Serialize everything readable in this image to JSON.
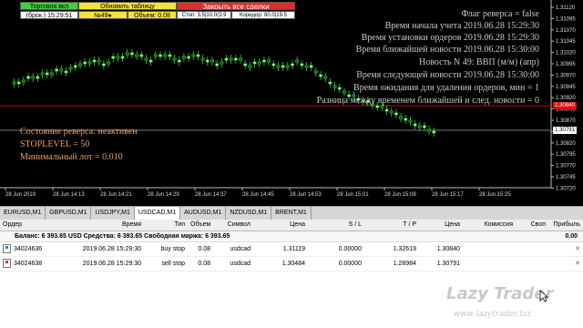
{
  "panel": {
    "row1": [
      "Торговля вкл",
      "Обновить таблицу",
      "Закрыть все сделки"
    ],
    "row2": [
      "(брок.) 15:29:51",
      "№49●",
      "Объем: 0.08",
      "Стоп: 3.5|10.0(3.9",
      "Коридор: 80.0|19.5"
    ],
    "colors": {
      "green": "#3dd23d",
      "yellow": "#f2e23a",
      "red": "#e12c2c",
      "white": "#ffffff"
    }
  },
  "info_lines": [
    "Флаг реверса = false",
    "Время начала учета 2019.06.28 15:29:30",
    "Время установки ордеров 2019.06.28 15:29:30",
    "Время ближайшей новости 2019.06.28 15:30:00",
    "Новость N 49: ВВП (м/м)  (апр)",
    "Время следующей новости 2019.06.28 15:30:00",
    "Время ожидания для удаления ордеров, мин = 1",
    "Разница между временем ближайшей и след. новости = 0"
  ],
  "status_lines": [
    "Состояние реверса: неактивен",
    "STOPLEVEL = 50",
    "Минимальный лот = 0.010"
  ],
  "price_scale": [
    "1.31120",
    "1.31095",
    "1.31070",
    "1.31045",
    "1.31020",
    "1.30995",
    "1.30970",
    "1.30945",
    "1.30920",
    "1.30895",
    "1.30870",
    "1.30845",
    "1.30820",
    "1.30795",
    "1.30770",
    "1.30745",
    "1.30720"
  ],
  "price_markers": {
    "red": "1.30840",
    "white": "1.30791"
  },
  "time_labels": [
    "28 Jun 2019",
    "28 Jun 14:13",
    "28 Jun 14:21",
    "28 Jun 14:29",
    "28 Jun 14:37",
    "28 Jun 14:45",
    "28 Jun 14:53",
    "28 Jun 15:01",
    "28 Jun 15:09",
    "28 Jun 15:17",
    "28 Jun 15:25"
  ],
  "tabs": [
    "EURUSD,M1",
    "GBPUSD,M1",
    "USDJPY,M1",
    "USDCAD,M1",
    "AUDUSD,M1",
    "NZDUSD,M1",
    "BRENT,M1"
  ],
  "active_tab": "USDCAD,M1",
  "table": {
    "headers": [
      "Ордер",
      "Время",
      "Тип",
      "Объем",
      "Символ",
      "Цена",
      "S / L",
      "T / P",
      "Цена",
      "Комиссия",
      "Своп",
      "Прибыль"
    ],
    "balance": "Баланс: 6 393.65 USD  Средства: 6 393.65  Свободная маржа: 6 393.65",
    "balance_value": "0.00",
    "rows": [
      [
        "34024636",
        "2019.06.28 15:29:30",
        "buy stop",
        "0.08",
        "usdcad",
        "1.31119",
        "0.00000",
        "1.32619",
        "1.30840",
        "",
        "",
        ""
      ],
      [
        "34024638",
        "2019.06.28 15:29:30",
        "sell stop",
        "0.08",
        "usdcad",
        "1.30484",
        "0.00000",
        "1.28984",
        "1.30791",
        "",
        "",
        ""
      ]
    ]
  },
  "watermark": {
    "title": "Lazy Trader",
    "url": "www.lazytrader.biz"
  }
}
